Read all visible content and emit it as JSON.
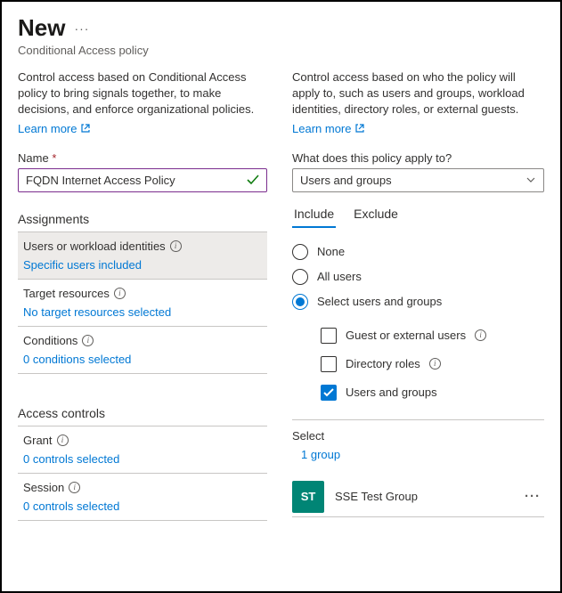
{
  "header": {
    "title": "New",
    "subtitle": "Conditional Access policy"
  },
  "left": {
    "desc": "Control access based on Conditional Access policy to bring signals together, to make decisions, and enforce organizational policies.",
    "learn_more": "Learn more",
    "name_label": "Name",
    "name_value": "FQDN Internet Access Policy",
    "assignments_head": "Assignments",
    "users": {
      "title": "Users or workload identities",
      "value": "Specific users included"
    },
    "target": {
      "title": "Target resources",
      "value": "No target resources selected"
    },
    "conditions": {
      "title": "Conditions",
      "value": "0 conditions selected"
    },
    "access_head": "Access controls",
    "grant": {
      "title": "Grant",
      "value": "0 controls selected"
    },
    "session": {
      "title": "Session",
      "value": "0 controls selected"
    }
  },
  "right": {
    "desc": "Control access based on who the policy will apply to, such as users and groups, workload identities, directory roles, or external guests.",
    "learn_more": "Learn more",
    "apply_label": "What does this policy apply to?",
    "apply_value": "Users and groups",
    "tabs": {
      "include": "Include",
      "exclude": "Exclude"
    },
    "radios": {
      "none": "None",
      "all": "All users",
      "select": "Select users and groups"
    },
    "checks": {
      "guest": "Guest or external users",
      "roles": "Directory roles",
      "groups": "Users and groups"
    },
    "select_label": "Select",
    "select_value": "1 group",
    "group": {
      "initials": "ST",
      "name": "SSE Test Group"
    }
  }
}
